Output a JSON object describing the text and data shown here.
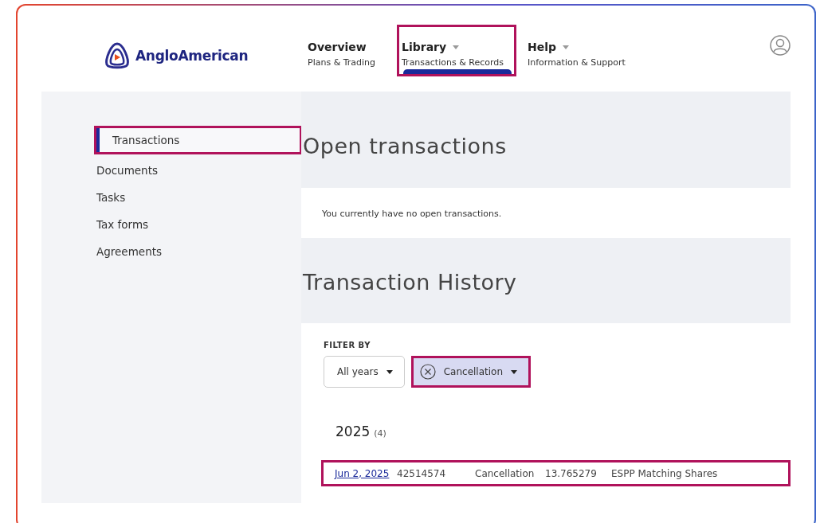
{
  "logo": {
    "text": "AngloAmerican"
  },
  "nav": [
    {
      "title": "Overview",
      "subtitle": "Plans & Trading",
      "dropdown": false,
      "selected": false,
      "highlighted": false
    },
    {
      "title": "Library",
      "subtitle": "Transactions & Records",
      "dropdown": true,
      "selected": true,
      "highlighted": true
    },
    {
      "title": "Help",
      "subtitle": "Information & Support",
      "dropdown": true,
      "selected": false,
      "highlighted": false
    }
  ],
  "sidebar": {
    "items": [
      {
        "label": "Transactions",
        "selected": true,
        "highlighted": true
      },
      {
        "label": "Documents",
        "selected": false,
        "highlighted": false
      },
      {
        "label": "Tasks",
        "selected": false,
        "highlighted": false
      },
      {
        "label": "Tax forms",
        "selected": false,
        "highlighted": false
      },
      {
        "label": "Agreements",
        "selected": false,
        "highlighted": false
      }
    ]
  },
  "open_transactions": {
    "title": "Open transactions",
    "message": "You currently have no open transactions."
  },
  "history": {
    "title": "Transaction History",
    "filter_label": "FILTER BY",
    "filters": [
      {
        "label": "All years",
        "active": false,
        "highlighted": false
      },
      {
        "label": "Cancellation",
        "active": true,
        "highlighted": true
      }
    ],
    "year": "2025",
    "count": "(4)",
    "rows": [
      {
        "date": "Jun 2, 2025",
        "id": "42514574",
        "type": "Cancellation",
        "amount": "13.765279",
        "plan": "ESPP Matching Shares",
        "highlighted": true
      }
    ]
  }
}
